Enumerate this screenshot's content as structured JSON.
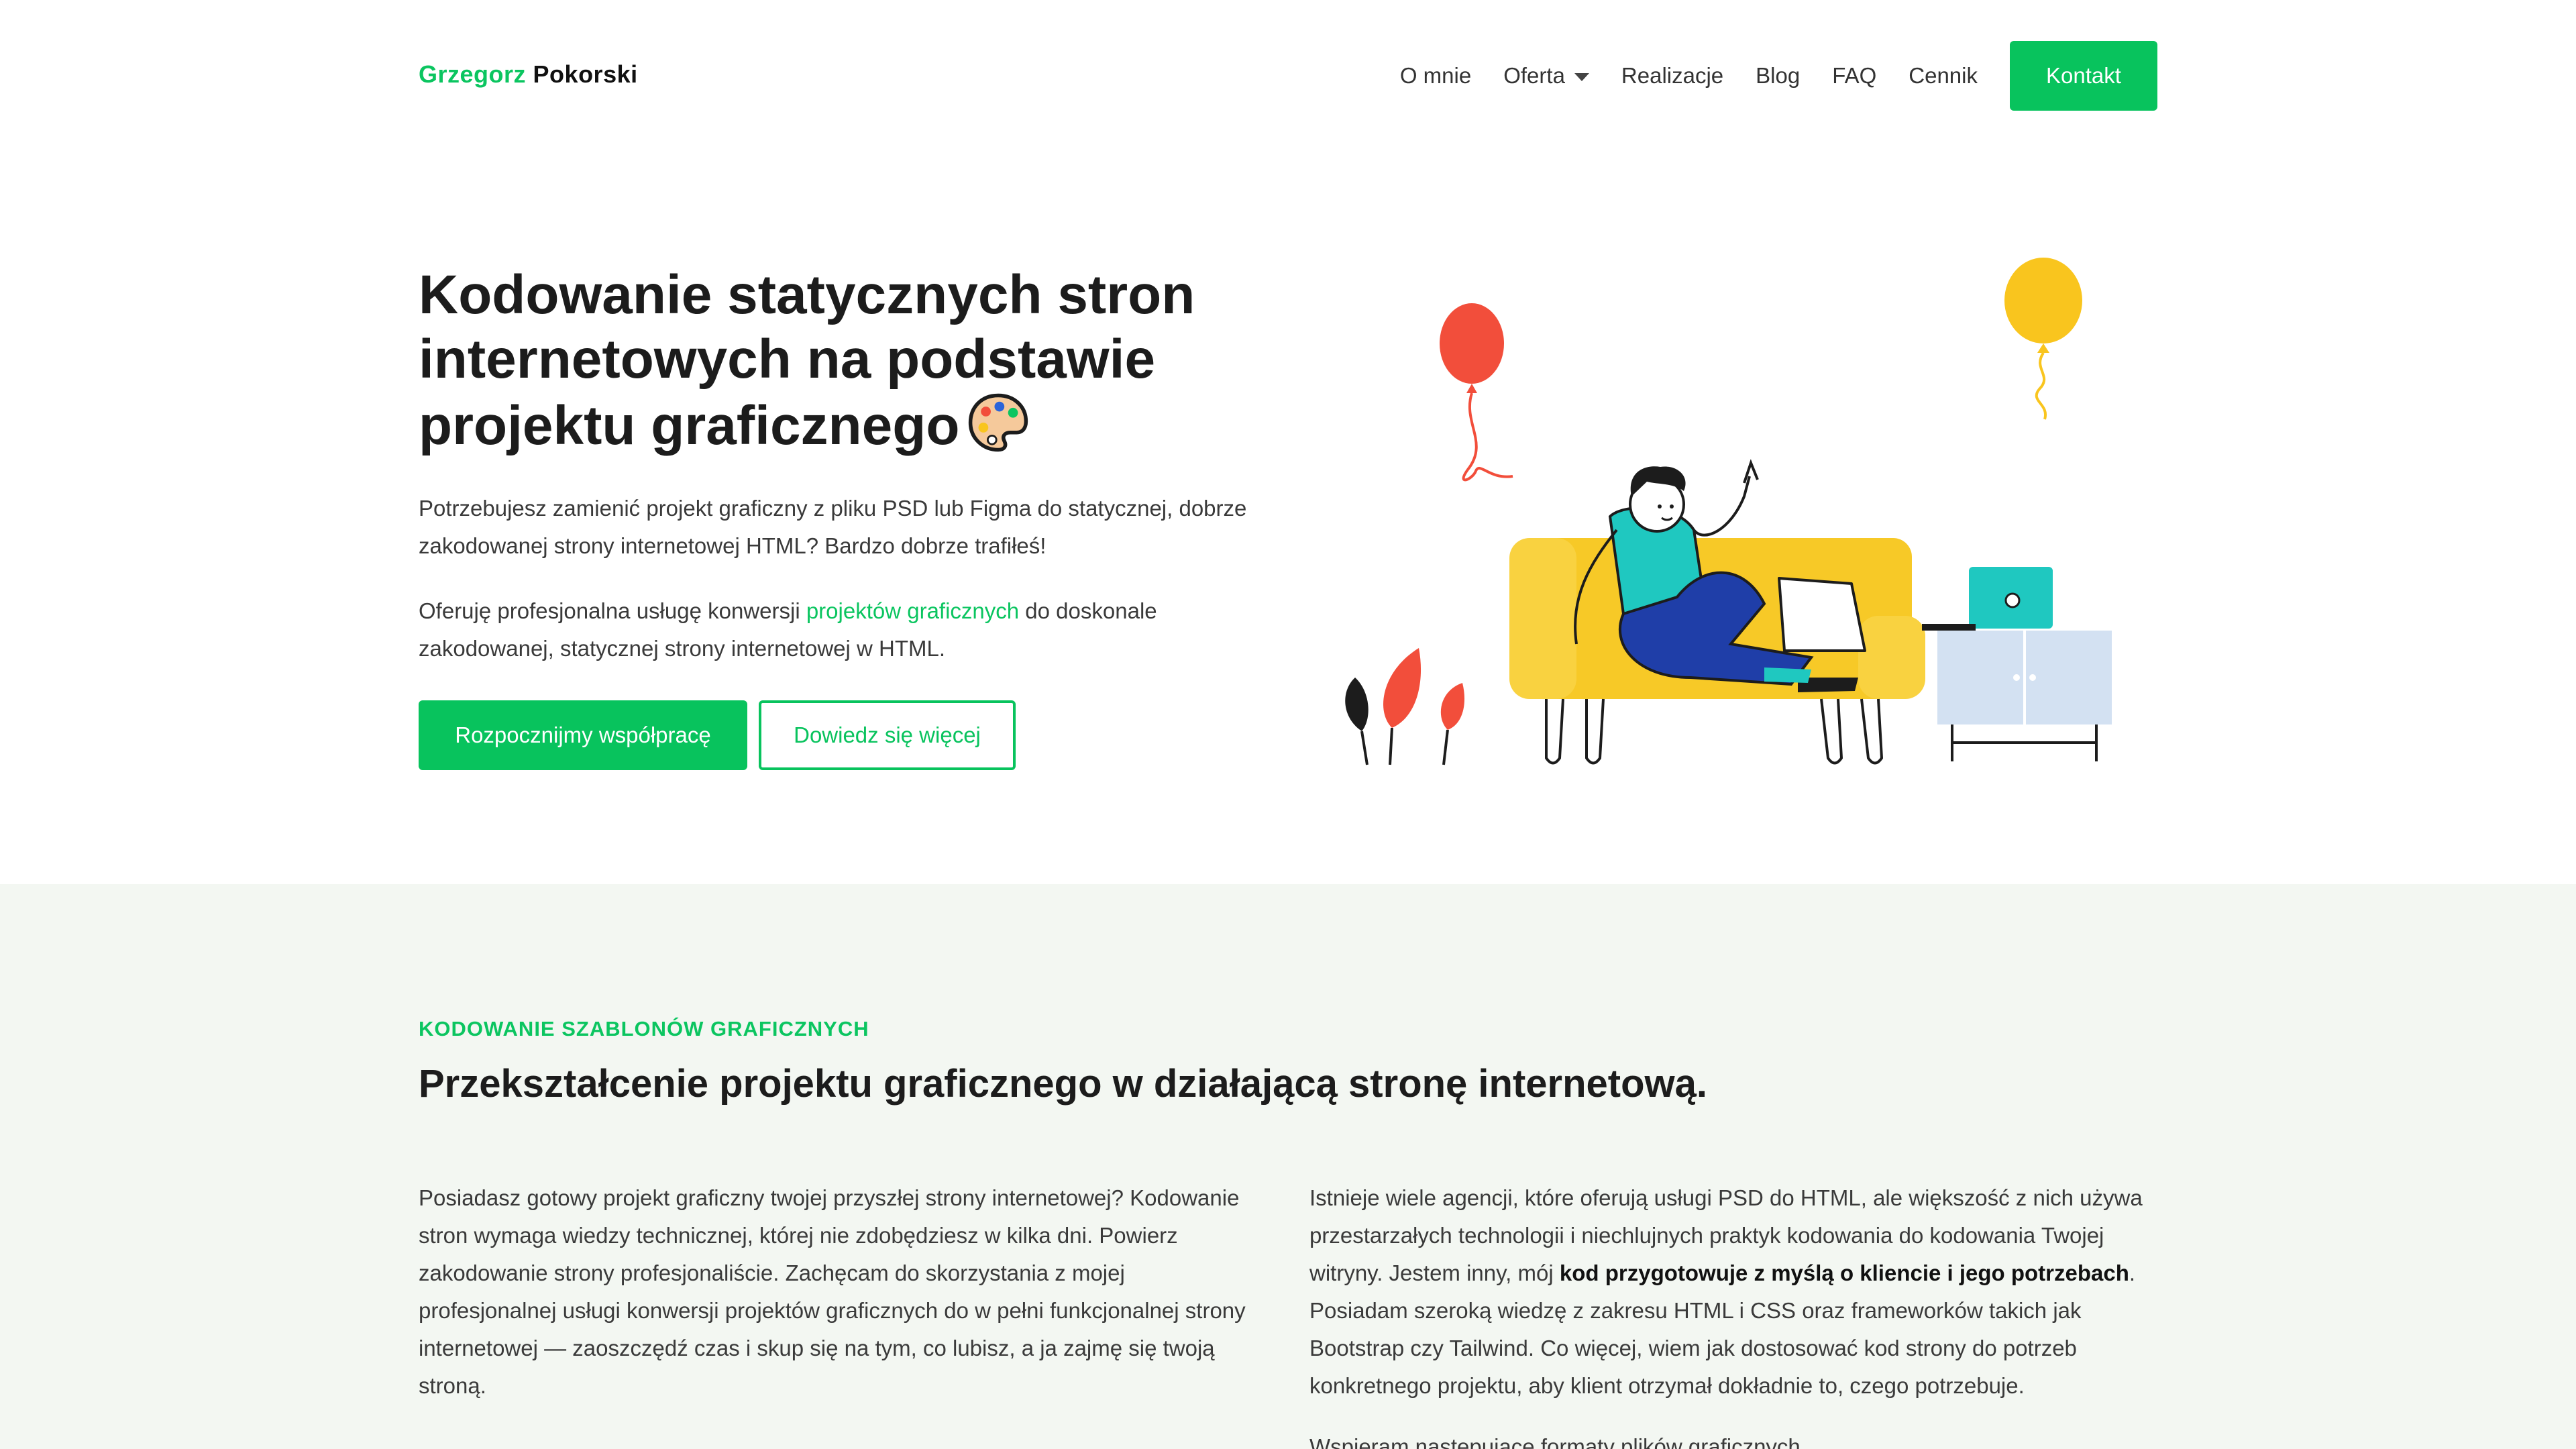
{
  "header": {
    "logo_first": "Grzegorz",
    "logo_last": "Pokorski",
    "nav": [
      "O mnie",
      "Oferta",
      "Realizacje",
      "Blog",
      "FAQ",
      "Cennik"
    ],
    "cta": "Kontakt"
  },
  "hero": {
    "title": "Kodowanie statycznych stron internetowych na podstawie projektu graficznego",
    "p1": "Potrzebujesz zamienić projekt graficzny z pliku PSD lub Figma do statycznej, dobrze zakodowanej strony internetowej HTML? Bardzo dobrze trafiłeś!",
    "p2_before": "Oferuję profesjonalna usługę konwersji ",
    "p2_link": "projektów graficznych",
    "p2_after": " do doskonale zakodowanej, statycznej strony internetowej w HTML.",
    "btn_primary": "Rozpocznijmy współpracę",
    "btn_secondary": "Dowiedz się więcej"
  },
  "section": {
    "eyebrow": "KODOWANIE SZABLONÓW GRAFICZNYCH",
    "title": "Przekształcenie projektu graficznego w działającą stronę internetową.",
    "left": "Posiadasz gotowy projekt graficzny twojej przyszłej strony internetowej? Kodowanie stron wymaga wiedzy technicznej, której nie zdobędziesz w kilka dni. Powierz zakodowanie strony profesjonaliście. Zachęcam do skorzystania z mojej profesjonalnej usługi konwersji projektów graficznych do w pełni funkcjonalnej strony internetowej — zaoszczędź czas i skup się na tym, co lubisz, a ja zajmę się twoją stroną.",
    "right_before": "Istnieje wiele agencji, które oferują usługi PSD do HTML, ale większość z nich używa przestarzałych technologii i niechlujnych praktyk kodowania do kodowania Twojej witryny. Jestem inny, mój ",
    "right_bold": "kod przygotowuje z myślą o kliencie i jego potrzebach",
    "right_after": ". Posiadam szeroką wiedzę z zakresu HTML i CSS oraz frameworków takich jak Bootstrap czy Tailwind. Co więcej, wiem jak dostosować kod strony do potrzeb konkretnego projektu, aby klient otrzymał dokładnie to, czego potrzebuje.",
    "right_next": "Wspieram następujące formaty plików graficznych"
  },
  "colors": {
    "accent": "#08c35d",
    "section_bg": "#f3f7f2",
    "sofa": "#f7c927",
    "balloon_red": "#f24e3b",
    "balloon_yellow": "#f9c51e",
    "laptop": "#1fc8c0",
    "cabinet": "#d3e1f2"
  },
  "icons": [
    "palette-icon",
    "chevron-down-icon"
  ]
}
